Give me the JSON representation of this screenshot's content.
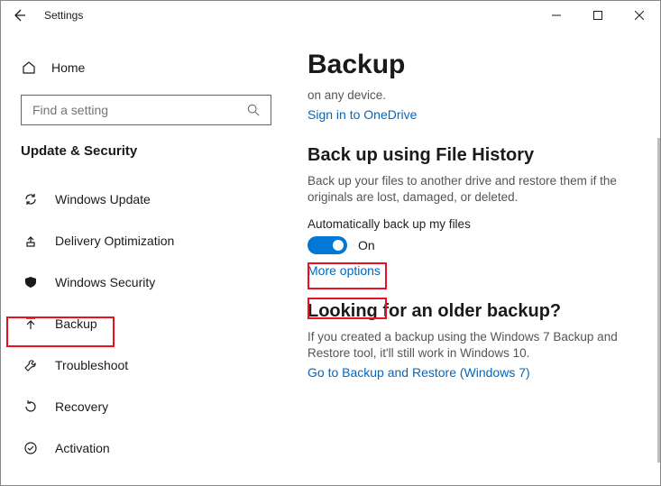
{
  "titlebar": {
    "title": "Settings"
  },
  "sidebar": {
    "home_label": "Home",
    "search_placeholder": "Find a setting",
    "category": "Update & Security",
    "items": [
      {
        "label": "Windows Update"
      },
      {
        "label": "Delivery Optimization"
      },
      {
        "label": "Windows Security"
      },
      {
        "label": "Backup"
      },
      {
        "label": "Troubleshoot"
      },
      {
        "label": "Recovery"
      },
      {
        "label": "Activation"
      }
    ]
  },
  "main": {
    "heading": "Backup",
    "intro_line": "on any device.",
    "signin_link": "Sign in to OneDrive",
    "filehistory": {
      "heading": "Back up using File History",
      "desc": "Back up your files to another drive and restore them if the originals are lost, damaged, or deleted.",
      "toggle_label": "Automatically back up my files",
      "toggle_state": "On",
      "more_options": "More options"
    },
    "older": {
      "heading": "Looking for an older backup?",
      "desc": "If you created a backup using the Windows 7 Backup and Restore tool, it'll still work in Windows 10.",
      "link": "Go to Backup and Restore (Windows 7)"
    }
  }
}
